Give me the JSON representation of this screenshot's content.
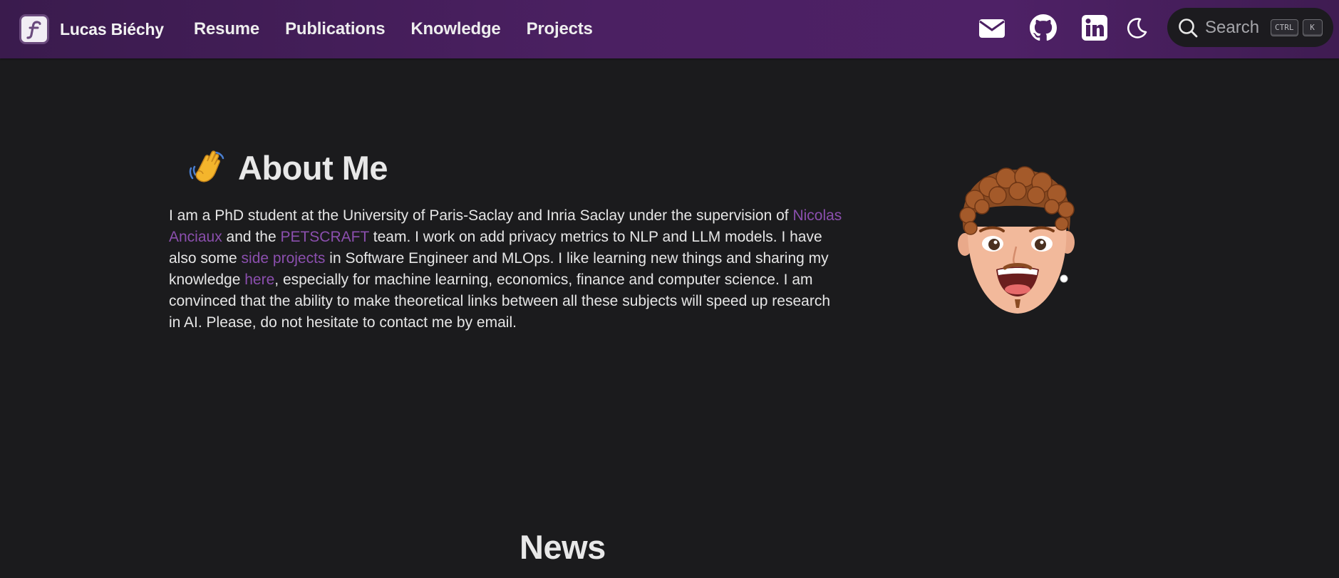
{
  "navbar": {
    "brand_title": "Lucas Biéchy",
    "links": [
      "Resume",
      "Publications",
      "Knowledge",
      "Projects"
    ],
    "search": {
      "placeholder": "Search",
      "kbd_ctrl": "CTRL",
      "kbd_k": "K"
    },
    "icons": [
      "mail-icon",
      "github-icon",
      "linkedin-icon",
      "moon-icon",
      "search-icon"
    ]
  },
  "about": {
    "title": "About Me",
    "emoji": "waving-hand",
    "text_1": "I am a PhD student at the University of Paris-Saclay and Inria Saclay under the supervision of ",
    "link_advisor": "Nicolas Anciaux",
    "text_2": " and the ",
    "link_team": "PETSCRAFT",
    "text_3": " team. I work on add privacy metrics to NLP and LLM models. I have also some ",
    "link_projects": "side projects",
    "text_4": " in Software Engineer and MLOps. I like learning new things and sharing my knowledge ",
    "link_here": "here",
    "text_5": ", especially for machine learning, economics, finance and computer science. I am convinced that the ability to make theoretical links between all these subjects will speed up research in AI. Please, do not hesitate to contact me by email."
  },
  "news": {
    "title": "News"
  },
  "colors": {
    "accent_link": "#8b4fae",
    "navbar": "#4b2062",
    "background": "#1b1b1d"
  }
}
